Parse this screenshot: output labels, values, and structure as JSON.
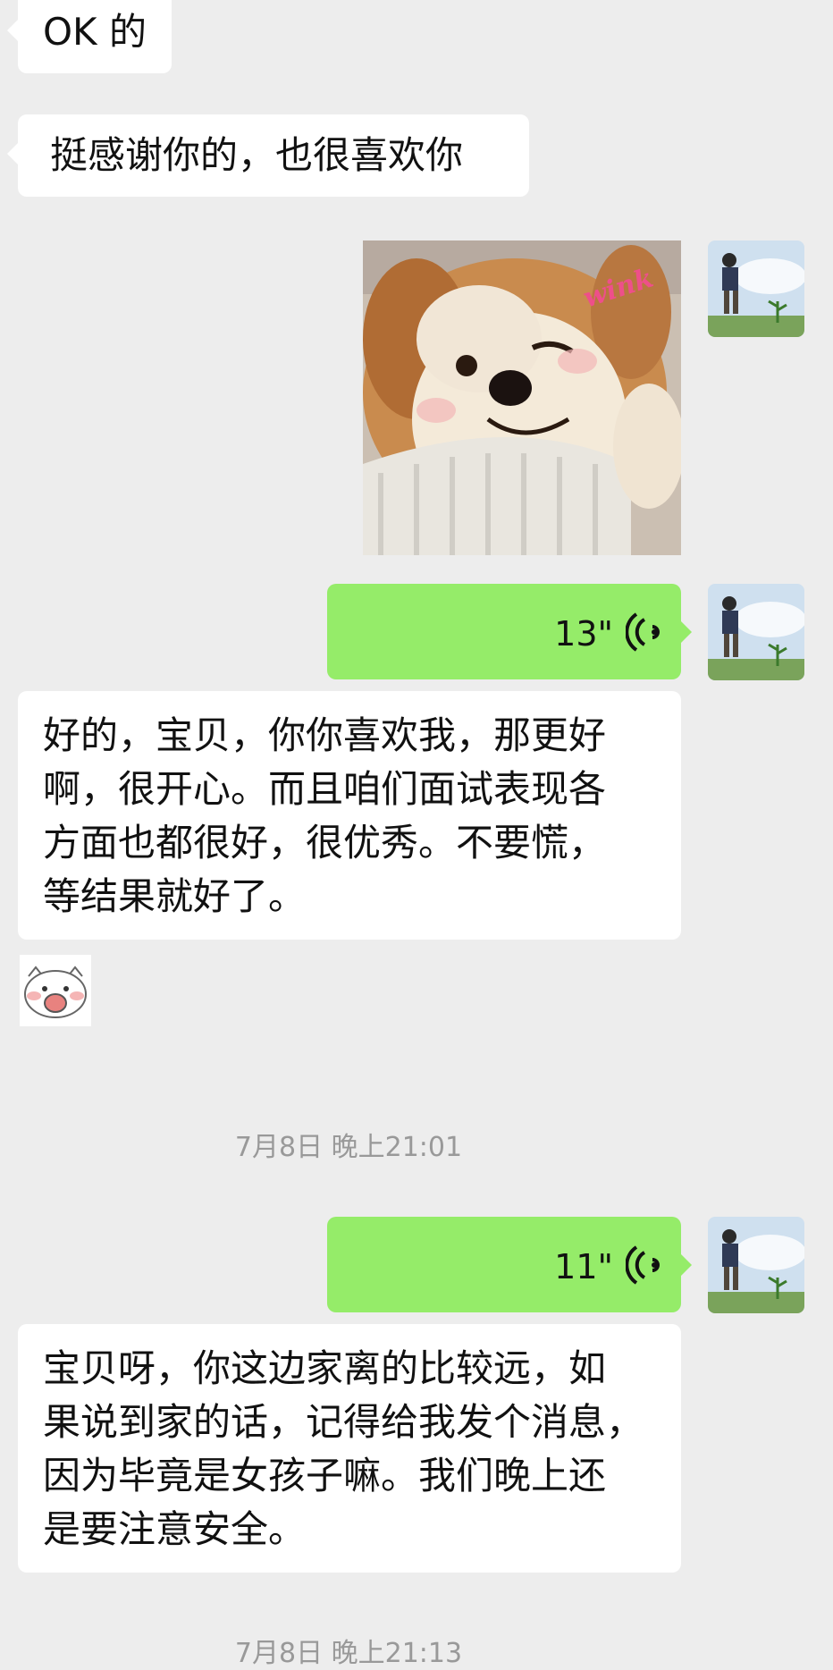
{
  "messages": {
    "m1": {
      "text": "OK 的"
    },
    "m2": {
      "text": "挺感谢你的，也很喜欢你"
    },
    "m3": {
      "sticker_caption": "wink"
    },
    "m4": {
      "duration": "13\""
    },
    "m5": {
      "lines": [
        "好的，宝贝，你你喜欢我，那更好",
        "啊，很开心。而且咱们面试表现各",
        "方面也都很好，很优秀。不要慌，",
        "等结果就好了。"
      ]
    },
    "m6": {
      "sticker": "pig-face"
    },
    "ts1": {
      "text": "7月8日 晚上21:01"
    },
    "m7": {
      "duration": "11\""
    },
    "m8": {
      "lines": [
        "宝贝呀，你这边家离的比较远，如",
        "果说到家的话，记得给我发个消息，",
        "因为毕竟是女孩子嘛。我们晚上还",
        "是要注意安全。"
      ]
    },
    "ts2": {
      "text": "7月8日 晚上21:13"
    }
  },
  "colors": {
    "background": "#ededed",
    "incoming_bubble": "#ffffff",
    "outgoing_bubble": "#95ec69",
    "timestamp": "#999999"
  },
  "icons": [
    "voice-wave-icon",
    "avatar",
    "pig-sticker",
    "dog-sticker"
  ]
}
